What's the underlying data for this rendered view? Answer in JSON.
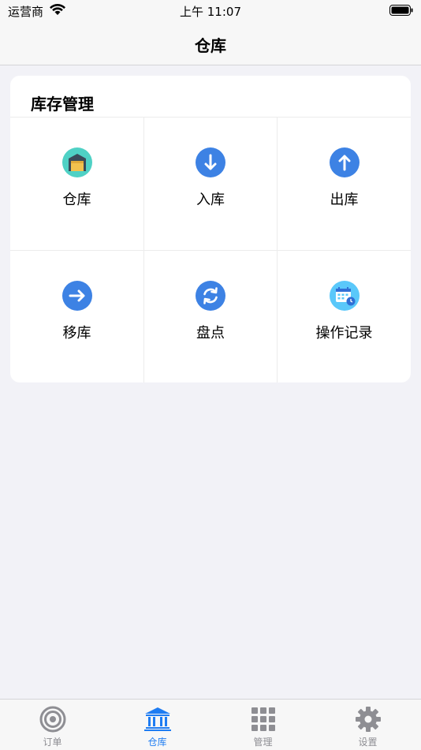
{
  "status_bar": {
    "carrier": "运营商",
    "time": "上午 11:07"
  },
  "nav": {
    "title": "仓库"
  },
  "card": {
    "title": "库存管理",
    "items": [
      {
        "label": "仓库",
        "icon": "warehouse-icon"
      },
      {
        "label": "入库",
        "icon": "arrow-down-icon"
      },
      {
        "label": "出库",
        "icon": "arrow-up-icon"
      },
      {
        "label": "移库",
        "icon": "arrow-right-icon"
      },
      {
        "label": "盘点",
        "icon": "refresh-icon"
      },
      {
        "label": "操作记录",
        "icon": "calendar-clock-icon"
      }
    ]
  },
  "tabs": [
    {
      "label": "订单",
      "icon": "target-icon",
      "active": false
    },
    {
      "label": "仓库",
      "icon": "bank-icon",
      "active": true
    },
    {
      "label": "管理",
      "icon": "grid-icon",
      "active": false
    },
    {
      "label": "设置",
      "icon": "gear-icon",
      "active": false
    }
  ],
  "colors": {
    "accent": "#1e7cf2",
    "icon_blue": "#3d82e4",
    "teal": "#4fd1c5",
    "inactive": "#8e8e93"
  }
}
